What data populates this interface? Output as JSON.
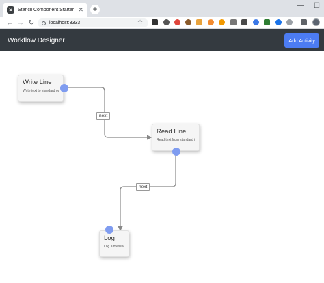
{
  "browser": {
    "tab_title": "Stencil Component Starter",
    "tab_favicon": "S",
    "url": "localhost:3333",
    "new_tab": "+",
    "window_controls": [
      "—",
      "☐"
    ]
  },
  "navbar": {
    "brand": "Workflow Designer",
    "add_button": "Add Activity"
  },
  "activities": [
    {
      "title": "Write Line",
      "description": "Write text to standard out"
    },
    {
      "title": "Read Line",
      "description": "Read text from standard in"
    },
    {
      "title": "Log",
      "description": "Log a message"
    }
  ],
  "connections": [
    {
      "from": "Write Line",
      "to": "Read Line",
      "label": "next"
    },
    {
      "from": "Read Line",
      "to": "Log",
      "label": "next"
    }
  ],
  "colors": {
    "navbar_bg": "#343a40",
    "accent": "#4c7cf3",
    "port": "#7f9cf0"
  }
}
